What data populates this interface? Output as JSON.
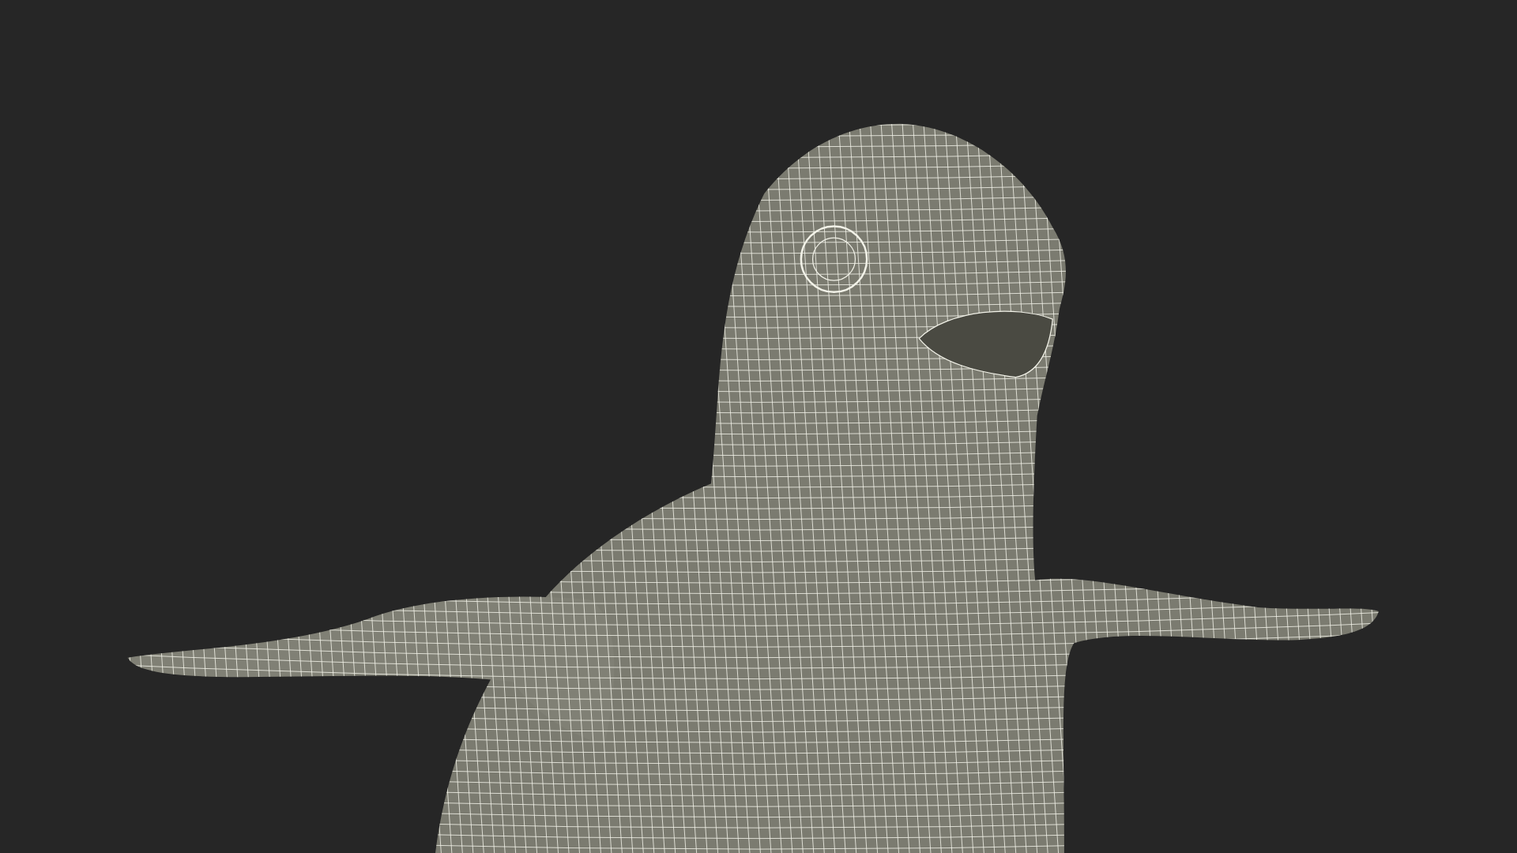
{
  "render": {
    "kind": "wireframe"
  }
}
